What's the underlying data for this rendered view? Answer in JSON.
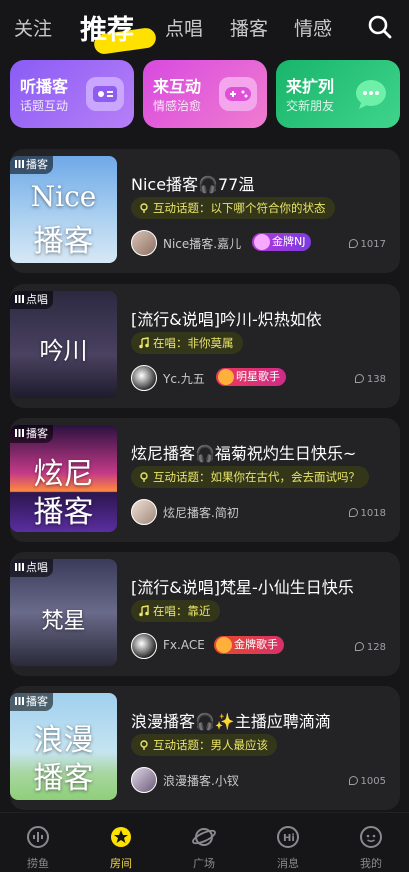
{
  "top_tabs": [
    "关注",
    "推荐",
    "点唱",
    "播客",
    "情感"
  ],
  "features": [
    {
      "title": "听播客",
      "subtitle": "话题互动"
    },
    {
      "title": "来互动",
      "subtitle": "情感治愈"
    },
    {
      "title": "来扩列",
      "subtitle": "交新朋友"
    }
  ],
  "cards": [
    {
      "tag": "播客",
      "cover_line1": "Nice",
      "cover_line2": "播客",
      "title": "Nice播客🎧77温",
      "topic": "互动话题：以下哪个符合你的状态",
      "host": "Nice播客.嘉儿",
      "badge": "金牌NJ",
      "count": "1017"
    },
    {
      "tag": "点唱",
      "cover_line1": "吟川",
      "cover_line2": "",
      "title": "[流行&说唱]吟川-炽热如依",
      "topic": "在唱：非你莫属",
      "host": "Yc.九五",
      "badge": "明星歌手",
      "count": "138"
    },
    {
      "tag": "播客",
      "cover_line1": "炫尼",
      "cover_line2": "播客",
      "title": "炫尼播客🎧福菊祝灼生日快乐~",
      "topic": "互动话题：如果你在古代，会去面试吗？",
      "host": "炫尼播客.简初",
      "badge": "",
      "count": "1018"
    },
    {
      "tag": "点唱",
      "cover_line1": "梵星",
      "cover_line2": "",
      "title": "[流行&说唱]梵星-小仙生日快乐",
      "topic": "在唱：靠近",
      "host": "Fx.ACE",
      "badge": "金牌歌手",
      "count": "128"
    },
    {
      "tag": "播客",
      "cover_line1": "浪漫",
      "cover_line2": "播客",
      "title": "浪漫播客🎧✨主播应聘滴滴",
      "topic": "互动话题：男人最应该",
      "host": "浪漫播客.小钗",
      "badge": "",
      "count": "1005"
    }
  ],
  "bottom_nav": [
    "捞鱼",
    "房间",
    "广场",
    "消息",
    "我的"
  ],
  "colors": {
    "accent": "#ffe100",
    "background": "#161618",
    "card": "#232326"
  }
}
